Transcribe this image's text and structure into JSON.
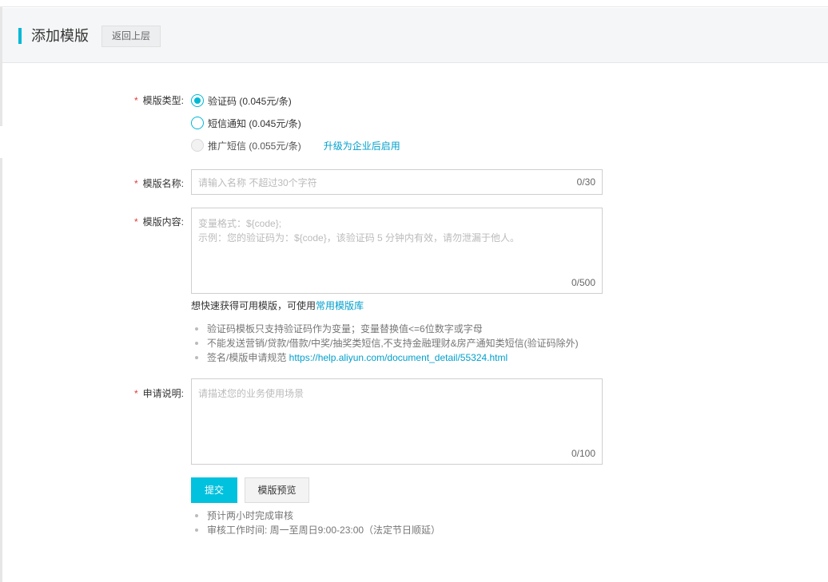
{
  "header": {
    "title": "添加模版",
    "back_label": "返回上层"
  },
  "form": {
    "template_type": {
      "required_mark": "*",
      "label": "模版类型:",
      "options": [
        {
          "label": "验证码 (0.045元/条)",
          "checked": true,
          "disabled": false
        },
        {
          "label": "短信通知 (0.045元/条)",
          "checked": false,
          "disabled": false
        },
        {
          "label": "推广短信 (0.055元/条)",
          "checked": false,
          "disabled": true
        }
      ],
      "upgrade_link": "升级为企业后启用"
    },
    "template_name": {
      "required_mark": "*",
      "label": "模版名称:",
      "placeholder": "请输入名称 不超过30个字符",
      "counter": "0/30"
    },
    "template_content": {
      "required_mark": "*",
      "label": "模版内容:",
      "placeholder": "变量格式：${code};\n 示例：您的验证码为：${code}，该验证码 5 分钟内有效，请勿泄漏于他人。",
      "counter": "0/500",
      "hint_text": "想快速获得可用模版，可使用",
      "hint_link": "常用模版库",
      "rules": [
        {
          "text": "验证码模板只支持验证码作为变量；变量替换值<=6位数字或字母",
          "link": ""
        },
        {
          "text": "不能发送营销/贷款/借款/中奖/抽奖类短信,不支持金融理财&房产通知类短信(验证码除外)",
          "link": ""
        },
        {
          "text": "签名/模版申请规范 ",
          "link": "https://help.aliyun.com/document_detail/55324.html"
        }
      ]
    },
    "application_desc": {
      "required_mark": "*",
      "label": "申请说明:",
      "placeholder": "请描述您的业务使用场景",
      "counter": "0/100"
    },
    "actions": {
      "submit_label": "提交",
      "preview_label": "模版预览"
    },
    "review_notes": [
      "预计两小时完成审核",
      "审核工作时间: 周一至周日9:00-23:00（法定节日顺延）"
    ]
  },
  "colors": {
    "accent": "#00c1de",
    "link": "#00a0cc",
    "required": "#e4393c"
  }
}
